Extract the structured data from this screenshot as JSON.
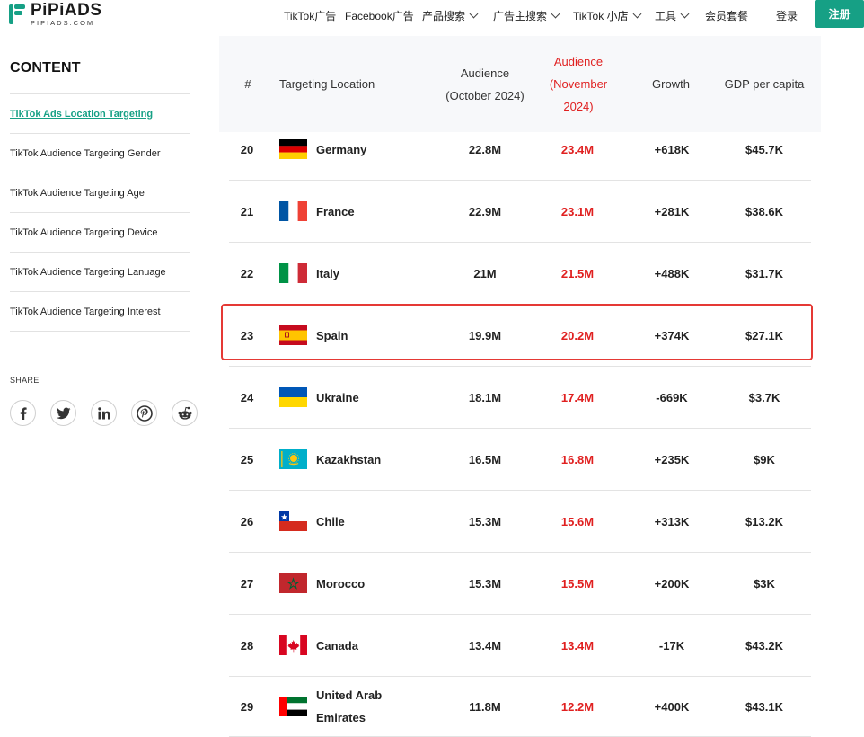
{
  "header": {
    "logo_text": "PiPiADS",
    "logo_sub": "PIPIADS.COM",
    "nav": [
      {
        "label": "TikTok广告",
        "dropdown": false
      },
      {
        "label": "Facebook广告",
        "dropdown": false
      },
      {
        "label": "产品搜索",
        "dropdown": true
      },
      {
        "label": "广告主搜索",
        "dropdown": true
      },
      {
        "label": "TikTok 小店",
        "dropdown": true
      },
      {
        "label": "工具",
        "dropdown": true
      },
      {
        "label": "会员套餐",
        "dropdown": false
      },
      {
        "label": "登录",
        "dropdown": false
      }
    ],
    "register_label": "注册",
    "accent_color": "#16a085"
  },
  "sidebar": {
    "title": "CONTENT",
    "items": [
      {
        "label": "TikTok Ads Location Targeting",
        "active": true
      },
      {
        "label": "TikTok Audience Targeting Gender",
        "active": false
      },
      {
        "label": "TikTok Audience Targeting Age",
        "active": false
      },
      {
        "label": "TikTok Audience Targeting Device",
        "active": false
      },
      {
        "label": "TikTok Audience Targeting Lanuage",
        "active": false
      },
      {
        "label": "TikTok Audience Targeting Interest",
        "active": false
      }
    ],
    "share_label": "SHARE",
    "share_icons": [
      "facebook-icon",
      "twitter-icon",
      "linkedin-icon",
      "pinterest-icon",
      "reddit-icon"
    ]
  },
  "table": {
    "headers": {
      "rank": "#",
      "location": "Targeting Location",
      "aud_oct_1": "Audience",
      "aud_oct_2": "(October 2024)",
      "aud_nov_1": "Audience",
      "aud_nov_2": "(November",
      "aud_nov_3": "2024)",
      "growth": "Growth",
      "gdp": "GDP per capita"
    },
    "highlight_color": "#e53935",
    "highlighted_rank": "23",
    "rows": [
      {
        "rank": "20",
        "country": "Germany",
        "flag": "germany",
        "oct": "22.8M",
        "nov": "23.4M",
        "growth": "+618K",
        "gdp": "$45.7K"
      },
      {
        "rank": "21",
        "country": "France",
        "flag": "france",
        "oct": "22.9M",
        "nov": "23.1M",
        "growth": "+281K",
        "gdp": "$38.6K"
      },
      {
        "rank": "22",
        "country": "Italy",
        "flag": "italy",
        "oct": "21M",
        "nov": "21.5M",
        "growth": "+488K",
        "gdp": "$31.7K"
      },
      {
        "rank": "23",
        "country": "Spain",
        "flag": "spain",
        "oct": "19.9M",
        "nov": "20.2M",
        "growth": "+374K",
        "gdp": "$27.1K"
      },
      {
        "rank": "24",
        "country": "Ukraine",
        "flag": "ukraine",
        "oct": "18.1M",
        "nov": "17.4M",
        "growth": "-669K",
        "gdp": "$3.7K"
      },
      {
        "rank": "25",
        "country": "Kazakhstan",
        "flag": "kazakhstan",
        "oct": "16.5M",
        "nov": "16.8M",
        "growth": "+235K",
        "gdp": "$9K"
      },
      {
        "rank": "26",
        "country": "Chile",
        "flag": "chile",
        "oct": "15.3M",
        "nov": "15.6M",
        "growth": "+313K",
        "gdp": "$13.2K"
      },
      {
        "rank": "27",
        "country": "Morocco",
        "flag": "morocco",
        "oct": "15.3M",
        "nov": "15.5M",
        "growth": "+200K",
        "gdp": "$3K"
      },
      {
        "rank": "28",
        "country": "Canada",
        "flag": "canada",
        "oct": "13.4M",
        "nov": "13.4M",
        "growth": "-17K",
        "gdp": "$43.2K"
      },
      {
        "rank": "29",
        "country": "United Arab Emirates",
        "country_line1": "United Arab",
        "country_line2": "Emirates",
        "flag": "uae",
        "oct": "11.8M",
        "nov": "12.2M",
        "growth": "+400K",
        "gdp": "$43.1K"
      }
    ]
  }
}
